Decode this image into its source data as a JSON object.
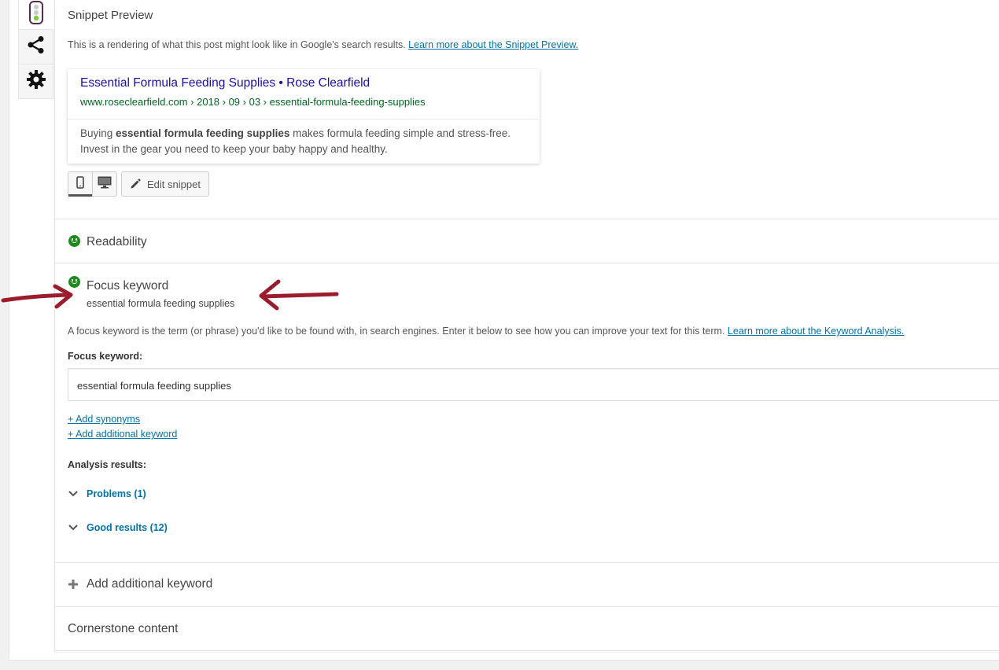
{
  "snippet_preview": {
    "title": "Snippet Preview",
    "intro_text": "This is a rendering of what this post might look like in Google's search results.",
    "learn_more_link": "Learn more about the Snippet Preview.",
    "result_title": "Essential Formula Feeding Supplies • Rose Clearfield",
    "result_url": "www.roseclearfield.com › 2018 › 09 › 03 › essential-formula-feeding-supplies",
    "desc_before": "Buying ",
    "desc_bold": "essential formula feeding supplies",
    "desc_after": " makes formula feeding simple and stress-free. Invest in the gear you need to keep your baby happy and healthy.",
    "edit_snippet_label": "Edit snippet"
  },
  "readability": {
    "title": "Readability"
  },
  "focus": {
    "title": "Focus keyword",
    "subtitle": "essential formula feeding supplies",
    "help_text": "A focus keyword is the term (or phrase) you'd like to be found with, in search engines. Enter it below to see how you can improve your text for this term.",
    "learn_more_link": "Learn more about the Keyword Analysis.",
    "field_label": "Focus keyword:",
    "field_value": "essential formula feeding supplies",
    "add_synonyms": "+ Add synonyms",
    "add_additional_keyword": "+ Add additional keyword",
    "analysis_label": "Analysis results:",
    "problems_label": "Problems (1)",
    "good_results_label": "Good results (12)"
  },
  "add_keyword_section": {
    "title": "Add additional keyword"
  },
  "cornerstone": {
    "title": "Cornerstone content"
  },
  "colors": {
    "link": "#0073aa",
    "serp_title": "#1a0dab",
    "serp_url": "#006621",
    "good": "#1e8a1e",
    "annotation_arrow": "#9b1c2c"
  }
}
